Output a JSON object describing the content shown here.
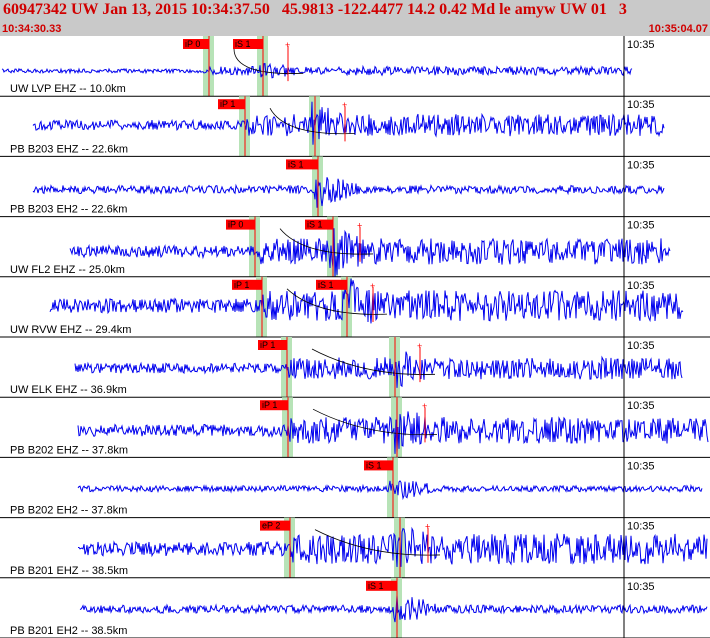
{
  "header": {
    "title": "60947342 UW Jan 13, 2015 10:34:37.50   45.9813 -122.4477 14.2 0.42 Md le amyw UW 01   3",
    "start_time": "10:34:30.33",
    "end_time": "10:35:04.07"
  },
  "colors": {
    "trace": "#0000ee",
    "pick": "#ff0000",
    "header_bg": "#c9c9c9",
    "pick_shade": "#b7e3b7",
    "label": "#000000"
  },
  "time_tick_label": "10:35",
  "panels": [
    {
      "label": "UW LVP  EHZ -- 10.0km",
      "p_label": "iP 0",
      "s_label": "iS 1"
    },
    {
      "label": "PB B203 EHZ -- 22.6km",
      "p_label": "iP 1",
      "s_label": ""
    },
    {
      "label": "PB B203 EH2 -- 22.6km",
      "p_label": "",
      "s_label": "iS 1"
    },
    {
      "label": "UW FL2  EHZ -- 25.0km",
      "p_label": "iP 0",
      "s_label": "iS 1"
    },
    {
      "label": "UW RVW  EHZ -- 29.4km",
      "p_label": "iP 1",
      "s_label": "iS 1"
    },
    {
      "label": "UW ELK  EHZ -- 36.9km",
      "p_label": "iP 1",
      "s_label": ""
    },
    {
      "label": "PB B202 EHZ -- 37.8km",
      "p_label": "iP 1",
      "s_label": ""
    },
    {
      "label": "PB B202 EH2 -- 37.8km",
      "p_label": "",
      "s_label": "iS 1"
    },
    {
      "label": "PB B201 EHZ -- 38.5km",
      "p_label": "eP 2",
      "s_label": ""
    },
    {
      "label": "PB B201 EH2 -- 38.5km",
      "p_label": "",
      "s_label": "iS 1"
    }
  ]
}
